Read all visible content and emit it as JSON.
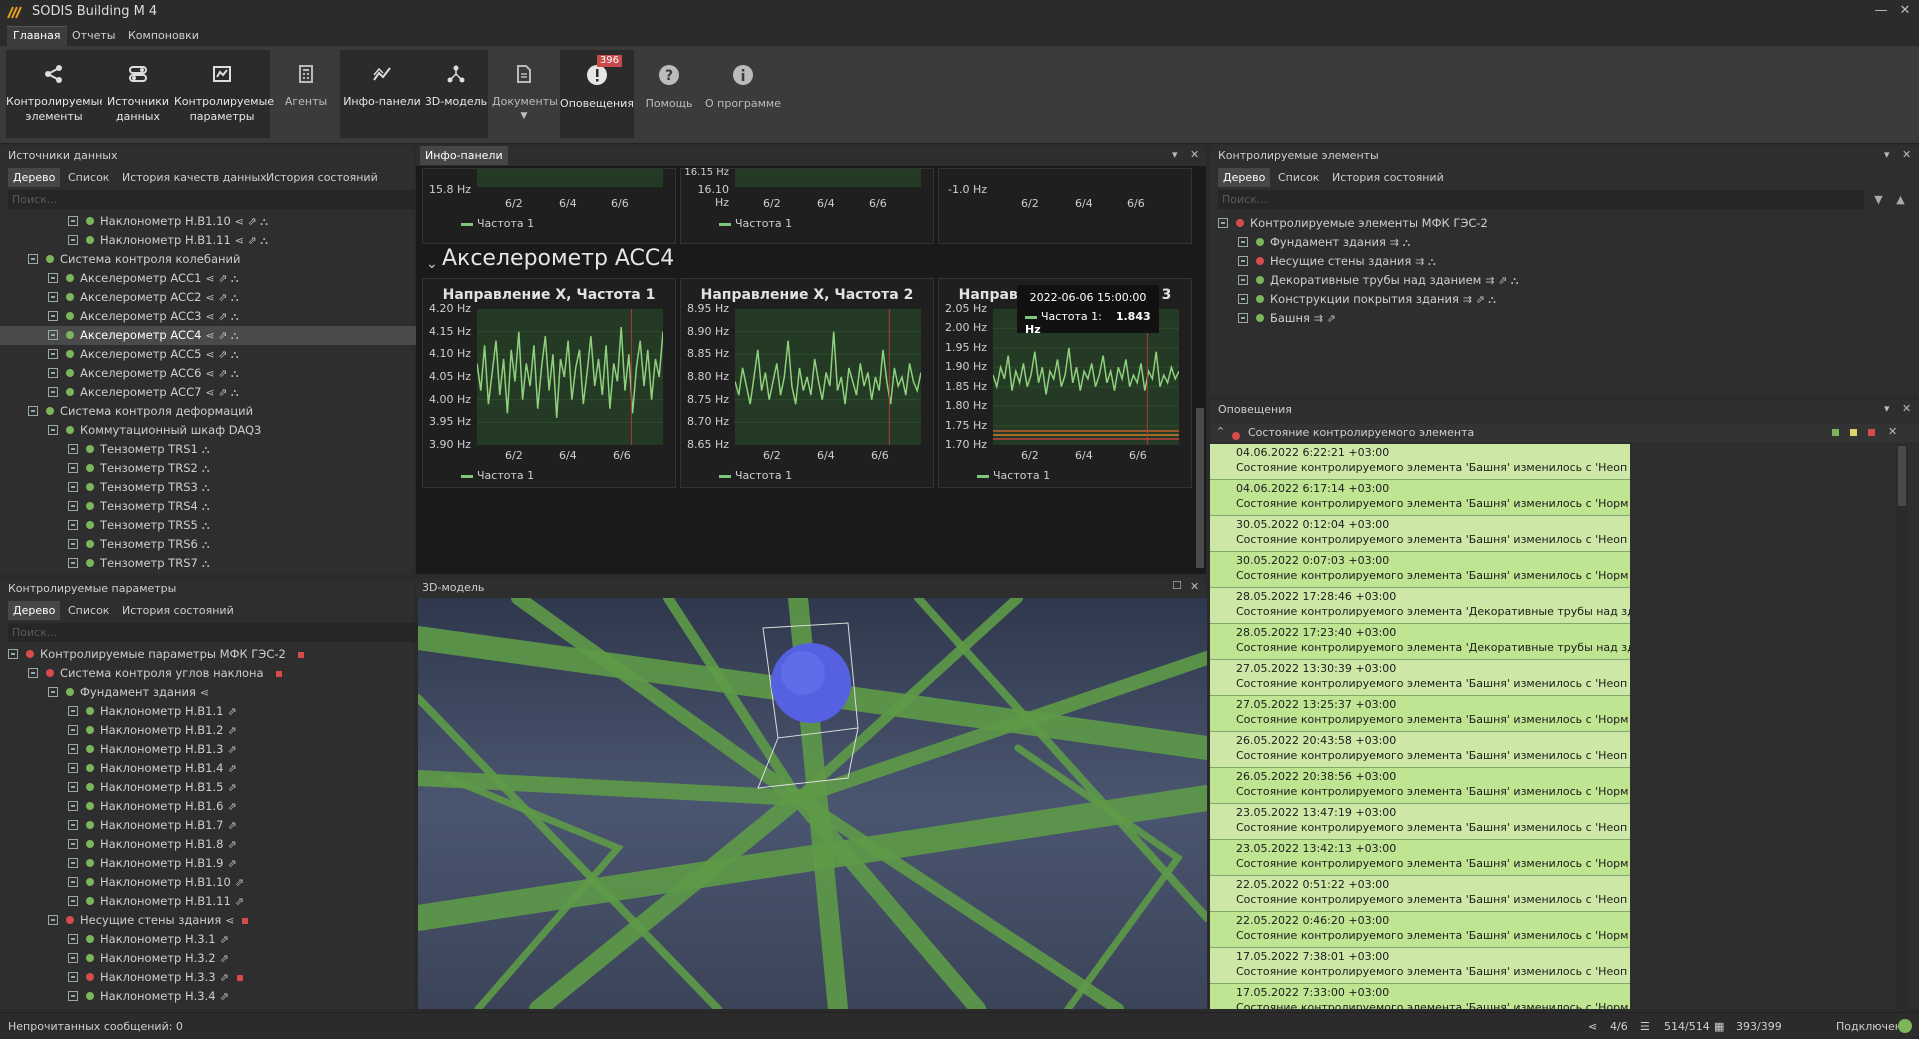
{
  "app": {
    "title": "SODIS Building M 4"
  },
  "menu": [
    "Главная",
    "Отчеты",
    "Компоновки"
  ],
  "ribbon": {
    "buttons": [
      {
        "label1": "Контролируемые",
        "label2": "элементы",
        "icon": "share-icon"
      },
      {
        "label1": "Источники",
        "label2": "данных",
        "icon": "toggle-icon"
      },
      {
        "label1": "Контролируемые",
        "label2": "параметры",
        "icon": "chart-icon"
      },
      {
        "label1": "Агенты",
        "label2": "",
        "icon": "calculator-icon"
      },
      {
        "label1": "Инфо-панели",
        "label2": "",
        "icon": "trend-icon"
      },
      {
        "label1": "3D-модель",
        "label2": "",
        "icon": "network-icon"
      },
      {
        "label1": "Документы",
        "label2": "",
        "icon": "document-icon"
      },
      {
        "label1": "Оповещения",
        "label2": "",
        "icon": "alert-icon",
        "badge": "396"
      },
      {
        "label1": "Помощь",
        "label2": "",
        "icon": "help-icon"
      },
      {
        "label1": "О программе",
        "label2": "",
        "icon": "info-icon"
      }
    ]
  },
  "sources": {
    "title": "Источники данных",
    "tabs": [
      "Дерево",
      "Список",
      "История качеств данных",
      "История состояний"
    ],
    "search": "Поиск...",
    "rows": [
      {
        "t": "Наклонометр Н.В1.10",
        "lvl": 3,
        "dot": "g",
        "icons": "⋖ ⇗ ⛬"
      },
      {
        "t": "Наклонометр Н.В1.11",
        "lvl": 3,
        "dot": "g",
        "icons": "⋖ ⇗ ⛬"
      },
      {
        "t": "Система контроля колебаний",
        "lvl": 1,
        "dot": "g",
        "icons": ""
      },
      {
        "t": "Акселерометр ACC1",
        "lvl": 2,
        "dot": "g",
        "icons": "⋖ ⇗ ⛬"
      },
      {
        "t": "Акселерометр ACC2",
        "lvl": 2,
        "dot": "g",
        "icons": "⋖ ⇗ ⛬"
      },
      {
        "t": "Акселерометр ACC3",
        "lvl": 2,
        "dot": "g",
        "icons": "⋖ ⇗ ⛬"
      },
      {
        "t": "Акселерометр ACC4",
        "lvl": 2,
        "dot": "g",
        "icons": "⋖ ⇗ ⛬",
        "sel": true
      },
      {
        "t": "Акселерометр ACC5",
        "lvl": 2,
        "dot": "g",
        "icons": "⋖ ⇗ ⛬"
      },
      {
        "t": "Акселерометр ACC6",
        "lvl": 2,
        "dot": "g",
        "icons": "⋖ ⇗ ⛬"
      },
      {
        "t": "Акселерометр ACC7",
        "lvl": 2,
        "dot": "g",
        "icons": "⋖ ⇗ ⛬"
      },
      {
        "t": "Система контроля деформаций",
        "lvl": 1,
        "dot": "g",
        "icons": ""
      },
      {
        "t": "Коммутационный шкаф DAQ3",
        "lvl": 2,
        "dot": "g",
        "icons": ""
      },
      {
        "t": "Тензометр TRS1",
        "lvl": 3,
        "dot": "g",
        "icons": "⛬"
      },
      {
        "t": "Тензометр TRS2",
        "lvl": 3,
        "dot": "g",
        "icons": "⛬"
      },
      {
        "t": "Тензометр TRS3",
        "lvl": 3,
        "dot": "g",
        "icons": "⛬"
      },
      {
        "t": "Тензометр TRS4",
        "lvl": 3,
        "dot": "g",
        "icons": "⛬"
      },
      {
        "t": "Тензометр TRS5",
        "lvl": 3,
        "dot": "g",
        "icons": "⛬"
      },
      {
        "t": "Тензометр TRS6",
        "lvl": 3,
        "dot": "g",
        "icons": "⛬"
      },
      {
        "t": "Тензометр TRS7",
        "lvl": 3,
        "dot": "g",
        "icons": "⛬"
      }
    ]
  },
  "params": {
    "title": "Контролируемые параметры",
    "tabs": [
      "Дерево",
      "Список",
      "История состояний"
    ],
    "search": "Поиск...",
    "rows": [
      {
        "t": "Контролируемые параметры МФК ГЭС-2",
        "lvl": 0,
        "dot": "r",
        "icons": "",
        "sq": true
      },
      {
        "t": "Система контроля углов наклона",
        "lvl": 1,
        "dot": "r",
        "icons": "",
        "sq": true
      },
      {
        "t": "Фундамент здания",
        "lvl": 2,
        "dot": "g",
        "icons": "⋖"
      },
      {
        "t": "Наклонометр Н.В1.1",
        "lvl": 3,
        "dot": "g",
        "icons": "⇗"
      },
      {
        "t": "Наклонометр Н.В1.2",
        "lvl": 3,
        "dot": "g",
        "icons": "⇗"
      },
      {
        "t": "Наклонометр Н.В1.3",
        "lvl": 3,
        "dot": "g",
        "icons": "⇗"
      },
      {
        "t": "Наклонометр Н.В1.4",
        "lvl": 3,
        "dot": "g",
        "icons": "⇗"
      },
      {
        "t": "Наклонометр Н.В1.5",
        "lvl": 3,
        "dot": "g",
        "icons": "⇗"
      },
      {
        "t": "Наклонометр Н.В1.6",
        "lvl": 3,
        "dot": "g",
        "icons": "⇗"
      },
      {
        "t": "Наклонометр Н.В1.7",
        "lvl": 3,
        "dot": "g",
        "icons": "⇗"
      },
      {
        "t": "Наклонометр Н.В1.8",
        "lvl": 3,
        "dot": "g",
        "icons": "⇗"
      },
      {
        "t": "Наклонометр Н.В1.9",
        "lvl": 3,
        "dot": "g",
        "icons": "⇗"
      },
      {
        "t": "Наклонометр Н.В1.10",
        "lvl": 3,
        "dot": "g",
        "icons": "⇗"
      },
      {
        "t": "Наклонометр Н.В1.11",
        "lvl": 3,
        "dot": "g",
        "icons": "⇗"
      },
      {
        "t": "Несущие стены здания",
        "lvl": 2,
        "dot": "r",
        "icons": "⋖",
        "sq": true
      },
      {
        "t": "Наклонометр Н.3.1",
        "lvl": 3,
        "dot": "g",
        "icons": "⇗"
      },
      {
        "t": "Наклонометр Н.3.2",
        "lvl": 3,
        "dot": "g",
        "icons": "⇗"
      },
      {
        "t": "Наклонометр Н.3.3",
        "lvl": 3,
        "dot": "r",
        "icons": "⇗",
        "sq": true
      },
      {
        "t": "Наклонометр Н.3.4",
        "lvl": 3,
        "dot": "g",
        "icons": "⇗"
      }
    ]
  },
  "info": {
    "tab": "Инфо-панели",
    "section": "Акселерометр ACC4",
    "top": [
      {
        "y1": "15.8 Hz",
        "y0": "",
        "x": [
          "6/2",
          "6/4",
          "6/6"
        ],
        "legend": "Частота 1"
      },
      {
        "y1": "16.10 Hz",
        "y0": "16.15 Hz",
        "x": [
          "6/2",
          "6/4",
          "6/6"
        ],
        "legend": "Частота 1"
      },
      {
        "y1": "-1.0 Hz",
        "y0": "",
        "x": [
          "6/2",
          "6/4",
          "6/6"
        ],
        "legend": ""
      }
    ],
    "tooltip": {
      "date": "2022-06-06 15:00:00",
      "label": "Частота 1:",
      "value": "1.843 Hz"
    }
  },
  "chart_data": [
    {
      "type": "line",
      "title": "Направление X, Частота 1",
      "ylabels": [
        "4.20 Hz",
        "4.15 Hz",
        "4.10 Hz",
        "4.05 Hz",
        "4.00 Hz",
        "3.95 Hz",
        "3.90 Hz"
      ],
      "ylim": [
        3.9,
        4.2
      ],
      "categories": [
        "6/2",
        "6/4",
        "6/6"
      ],
      "series": [
        {
          "name": "Частота 1",
          "values": [
            4.08,
            4.02,
            4.12,
            3.99,
            4.06,
            4.13,
            4.01,
            4.09,
            3.97,
            4.11,
            4.04,
            4.15,
            4.0,
            4.08,
            4.03,
            4.12,
            3.98,
            4.07,
            4.14,
            4.02,
            4.1,
            3.96,
            4.09,
            4.05,
            4.13,
            4.0,
            4.07,
            4.11,
            3.99,
            4.06,
            4.14,
            4.03,
            4.09,
            4.01,
            4.12,
            3.98,
            4.08,
            4.04,
            4.16,
            4.02,
            4.1,
            3.97,
            4.07,
            4.13,
            4.03,
            4.11,
            4.0,
            4.09,
            4.05,
            4.15
          ]
        }
      ]
    },
    {
      "type": "line",
      "title": "Направление X, Частота 2",
      "ylabels": [
        "8.95 Hz",
        "8.90 Hz",
        "8.85 Hz",
        "8.80 Hz",
        "8.75 Hz",
        "8.70 Hz",
        "8.65 Hz"
      ],
      "ylim": [
        8.65,
        8.95
      ],
      "categories": [
        "6/2",
        "6/4",
        "6/6"
      ],
      "series": [
        {
          "name": "Частота 1",
          "values": [
            8.79,
            8.76,
            8.82,
            8.78,
            8.74,
            8.8,
            8.86,
            8.77,
            8.81,
            8.75,
            8.79,
            8.83,
            8.76,
            8.8,
            8.88,
            8.78,
            8.74,
            8.82,
            8.77,
            8.8,
            8.76,
            8.84,
            8.79,
            8.75,
            8.81,
            8.78,
            8.9,
            8.77,
            8.8,
            8.74,
            8.82,
            8.79,
            8.76,
            8.83,
            8.78,
            8.81,
            8.75,
            8.8,
            8.77,
            8.86,
            8.79,
            8.74,
            8.82,
            8.78,
            8.8,
            8.76,
            8.83,
            8.79,
            8.77,
            8.81
          ]
        }
      ]
    },
    {
      "type": "line",
      "title": "Направление X, Частота 3",
      "ylabels": [
        "2.05 Hz",
        "2.00 Hz",
        "1.95 Hz",
        "1.90 Hz",
        "1.85 Hz",
        "1.80 Hz",
        "1.75 Hz",
        "1.70 Hz"
      ],
      "ylim": [
        1.7,
        2.05
      ],
      "categories": [
        "6/2",
        "6/4",
        "6/6"
      ],
      "series": [
        {
          "name": "Частота 1",
          "values": [
            1.88,
            1.85,
            1.9,
            1.87,
            1.93,
            1.84,
            1.89,
            1.86,
            1.91,
            1.85,
            1.88,
            1.94,
            1.86,
            1.9,
            1.83,
            1.89,
            1.87,
            1.92,
            1.85,
            1.88,
            1.95,
            1.86,
            1.9,
            1.84,
            1.89,
            1.87,
            1.91,
            1.85,
            1.88,
            1.93,
            1.86,
            1.89,
            1.84,
            1.9,
            1.87,
            1.92,
            1.85,
            1.88,
            1.86,
            1.91,
            1.84,
            1.89,
            1.87,
            1.94,
            1.85,
            1.88,
            1.86,
            1.9,
            1.87,
            1.89
          ]
        }
      ]
    }
  ],
  "model3d": {
    "title": "3D-модель"
  },
  "elements": {
    "title": "Контролируемые элементы",
    "tabs": [
      "Дерево",
      "Список",
      "История состояний"
    ],
    "search": "Поиск...",
    "rows": [
      {
        "t": "Контролируемые элементы МФК ГЭС-2",
        "lvl": 0,
        "dot": "r",
        "icons": ""
      },
      {
        "t": "Фундамент здания",
        "lvl": 1,
        "dot": "g",
        "icons": "⇉ ⛬"
      },
      {
        "t": "Несущие стены здания",
        "lvl": 1,
        "dot": "r",
        "icons": "⇉ ⛬"
      },
      {
        "t": "Декоративные трубы над зданием",
        "lvl": 1,
        "dot": "g",
        "icons": "⇉ ⇗ ⛬"
      },
      {
        "t": "Конструкции покрытия здания",
        "lvl": 1,
        "dot": "g",
        "icons": "⇉ ⇗ ⛬"
      },
      {
        "t": "Башня",
        "lvl": 1,
        "dot": "g",
        "icons": "⇉ ⇗"
      }
    ]
  },
  "alerts": {
    "title": "Оповещения",
    "group": "Состояние контролируемого элемента",
    "items": [
      {
        "time": "04.06.2022 6:22:21 +03:00",
        "text": "Состояние контролируемого элемента 'Башня' изменилось с 'Неоп"
      },
      {
        "time": "04.06.2022 6:17:14 +03:00",
        "text": "Состояние контролируемого элемента 'Башня' изменилось с 'Норм"
      },
      {
        "time": "30.05.2022 0:12:04 +03:00",
        "text": "Состояние контролируемого элемента 'Башня' изменилось с 'Неоп"
      },
      {
        "time": "30.05.2022 0:07:03 +03:00",
        "text": "Состояние контролируемого элемента 'Башня' изменилось с 'Норм"
      },
      {
        "time": "28.05.2022 17:28:46 +03:00",
        "text": "Состояние контролируемого элемента 'Декоративные трубы над зд"
      },
      {
        "time": "28.05.2022 17:23:40 +03:00",
        "text": "Состояние контролируемого элемента 'Декоративные трубы над зд"
      },
      {
        "time": "27.05.2022 13:30:39 +03:00",
        "text": "Состояние контролируемого элемента 'Башня' изменилось с 'Неоп"
      },
      {
        "time": "27.05.2022 13:25:37 +03:00",
        "text": "Состояние контролируемого элемента 'Башня' изменилось с 'Норм"
      },
      {
        "time": "26.05.2022 20:43:58 +03:00",
        "text": "Состояние контролируемого элемента 'Башня' изменилось с 'Неоп"
      },
      {
        "time": "26.05.2022 20:38:56 +03:00",
        "text": "Состояние контролируемого элемента 'Башня' изменилось с 'Норм"
      },
      {
        "time": "23.05.2022 13:47:19 +03:00",
        "text": "Состояние контролируемого элемента 'Башня' изменилось с 'Неоп"
      },
      {
        "time": "23.05.2022 13:42:13 +03:00",
        "text": "Состояние контролируемого элемента 'Башня' изменилось с 'Норм"
      },
      {
        "time": "22.05.2022 0:51:22 +03:00",
        "text": "Состояние контролируемого элемента 'Башня' изменилось с 'Неоп"
      },
      {
        "time": "22.05.2022 0:46:20 +03:00",
        "text": "Состояние контролируемого элемента 'Башня' изменилось с 'Норм"
      },
      {
        "time": "17.05.2022 7:38:01 +03:00",
        "text": "Состояние контролируемого элемента 'Башня' изменилось с 'Неоп"
      },
      {
        "time": "17.05.2022 7:33:00 +03:00",
        "text": "Состояние контролируемого элемента 'Башня' изменилось с 'Норм"
      }
    ]
  },
  "status": {
    "unread": "Непрочитанных сообщений: 0",
    "elements": "4/6",
    "sources": "514/514",
    "params": "393/399",
    "conn": "Подключено"
  },
  "colors": {
    "line": "#8fd07d",
    "plot": "#243a24",
    "ok": "#7cb55a",
    "bad": "#d64b4b",
    "alert": "#cde8a6"
  }
}
